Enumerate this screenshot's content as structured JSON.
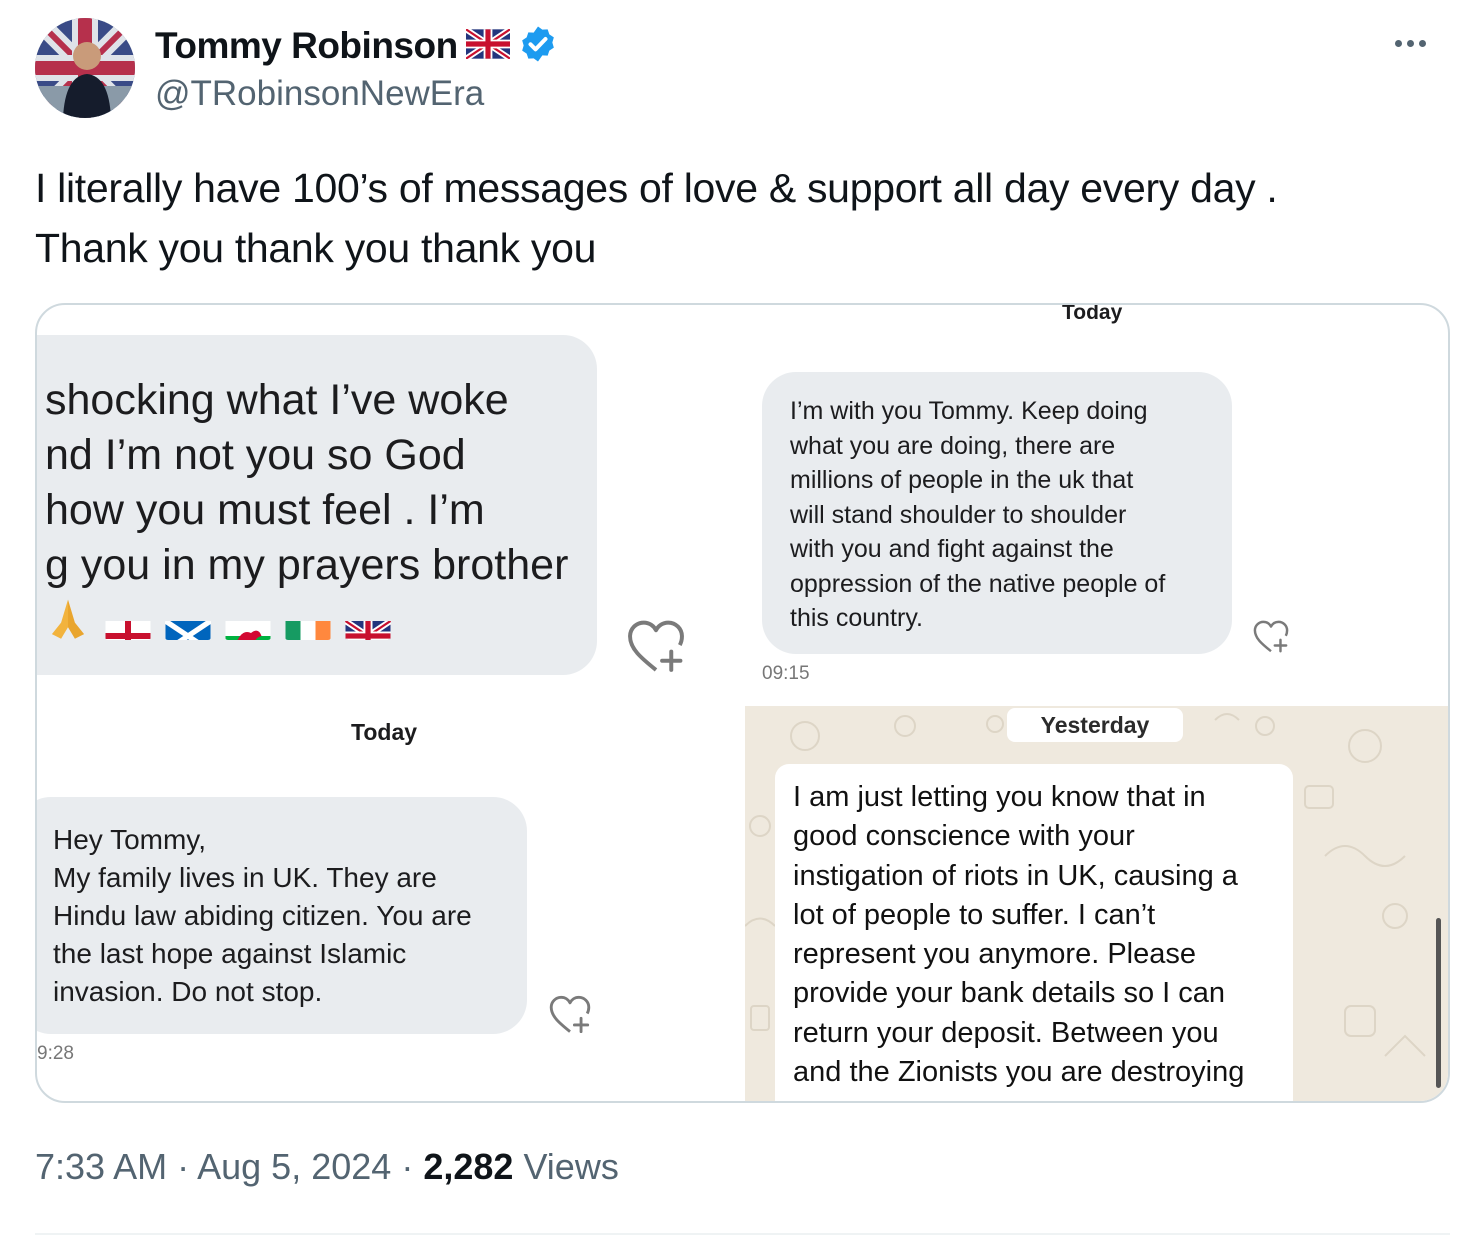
{
  "author": {
    "display_name": "Tommy Robinson",
    "handle": "@TRobinsonNewEra",
    "flag_icon": "uk-flag-icon",
    "verified_icon": "verified-badge-icon",
    "verified_color": "#1d9bf0"
  },
  "tweet": {
    "lines": [
      "I literally have 100’s of messages of love & support all day every day .",
      "Thank you thank you thank you"
    ]
  },
  "media": {
    "msg1": {
      "lines": [
        "shocking what I’ve woke",
        "nd I’m not you so God",
        "how you must feel . I’m",
        "g you in my prayers brother"
      ],
      "emojis": [
        "praying-hands-icon",
        "england-flag-icon",
        "scotland-flag-icon",
        "wales-flag-icon",
        "ireland-flag-icon",
        "uk-flag-icon"
      ]
    },
    "msg2": {
      "day_label": "Today",
      "lines": [
        "I’m with you Tommy. Keep doing",
        "what you are doing, there are",
        "millions of people in the uk that",
        "will stand shoulder to shoulder",
        "with you and fight against the",
        "oppression of the native people of",
        "this country."
      ],
      "time": "09:15"
    },
    "msg3": {
      "day_label": "Today",
      "lines": [
        "Hey Tommy,",
        "My family lives in UK. They are",
        "Hindu law abiding citizen. You are",
        "the last hope against Islamic",
        "invasion. Do not stop."
      ],
      "time": "9:28"
    },
    "msg4": {
      "day_label": "Yesterday",
      "lines": [
        "I am just letting you know that in",
        "good conscience with your",
        "instigation of riots in UK, causing a",
        "lot of people to suffer. I can’t",
        "represent you anymore. Please",
        "provide your bank details so I can",
        "return your deposit. Between you",
        "and the Zionists you are destroying"
      ]
    }
  },
  "meta": {
    "time": "7:33 AM",
    "separator": "·",
    "date": "Aug 5, 2024",
    "views_count": "2,282",
    "views_label": "Views"
  }
}
